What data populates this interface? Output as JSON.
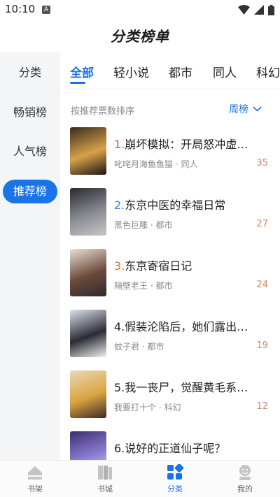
{
  "status_bar": {
    "time": "10:10",
    "notif_glyph": "A"
  },
  "header": {
    "title": "分类榜单"
  },
  "sidebar": {
    "items": [
      {
        "label": "分类",
        "active": false
      },
      {
        "label": "畅销榜",
        "active": false
      },
      {
        "label": "人气榜",
        "active": false
      },
      {
        "label": "推荐榜",
        "active": true
      }
    ]
  },
  "tabs": [
    {
      "label": "全部",
      "active": true
    },
    {
      "label": "轻小说",
      "active": false
    },
    {
      "label": "都市",
      "active": false
    },
    {
      "label": "同人",
      "active": false
    },
    {
      "label": "科幻",
      "active": false
    }
  ],
  "sort": {
    "label": "按推荐票数排序",
    "period": "周榜"
  },
  "books": [
    {
      "rank": "1.",
      "rank_color": "#c93ad3",
      "title": "崩坏模拟：开局怒冲虚…",
      "meta": "叱咤月海鱼鱼猫 · 同人",
      "votes": "35",
      "cover_colors": [
        "#3a2b1c",
        "#d6a24a",
        "#1c1410"
      ]
    },
    {
      "rank": "2.",
      "rank_color": "#3b82e8",
      "title": "东京中医的幸福日常",
      "meta": "黑色巨雕 · 都市",
      "votes": "27",
      "cover_colors": [
        "#2a2a2e",
        "#8a8c95",
        "#c9c6c4"
      ]
    },
    {
      "rank": "3.",
      "rank_color": "#e2722b",
      "title": "东京寄宿日记",
      "meta": "隔壁老王 · 都市",
      "votes": "24",
      "cover_colors": [
        "#e9dfd6",
        "#6b4a3b",
        "#2e2a2d"
      ]
    },
    {
      "rank": "4.",
      "rank_color": "#222222",
      "title": "假装沦陷后，她们露出…",
      "meta": "蚊子君 · 都市",
      "votes": "19",
      "cover_colors": [
        "#dde2ea",
        "#2b2b36",
        "#f2f2f4"
      ]
    },
    {
      "rank": "5.",
      "rank_color": "#222222",
      "title": "我一丧尸，觉醒黄毛系…",
      "meta": "我要打十个 · 科幻",
      "votes": "12",
      "cover_colors": [
        "#e9d8b8",
        "#d9a441",
        "#3b2a22"
      ]
    },
    {
      "rank": "6.",
      "rank_color": "#222222",
      "title": "说好的正道仙子呢？",
      "meta": "",
      "votes": "",
      "cover_colors": [
        "#3b3070",
        "#8f7fd6",
        "#e6e0f5"
      ]
    }
  ],
  "bottom_nav": {
    "items": [
      {
        "label": "书架",
        "icon": "bookshelf-icon",
        "active": false
      },
      {
        "label": "书城",
        "icon": "bookstore-icon",
        "active": false
      },
      {
        "label": "分类",
        "icon": "category-icon",
        "active": true
      },
      {
        "label": "我的",
        "icon": "profile-icon",
        "active": false
      }
    ]
  },
  "colors": {
    "accent": "#1a73e8",
    "sidebar_bg": "#f4f5f7",
    "votes": "#c98b63"
  }
}
